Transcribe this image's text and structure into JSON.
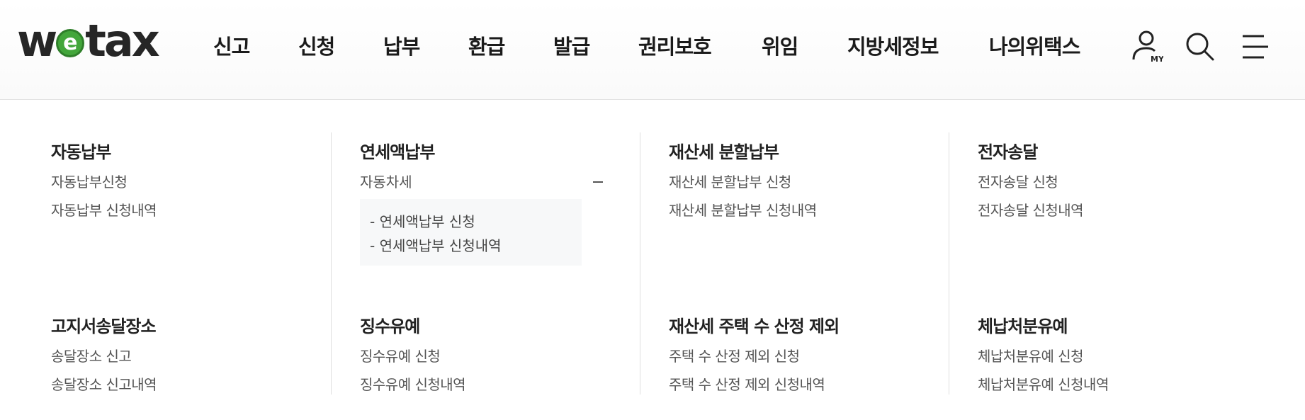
{
  "header": {
    "logo": {
      "w": "w",
      "e": "e",
      "tax": "tax"
    },
    "nav": [
      "신고",
      "신청",
      "납부",
      "환급",
      "발급",
      "권리보호",
      "위임",
      "지방세정보",
      "나의위택스"
    ],
    "icons": {
      "my": "user-my-icon",
      "my_label": "MY",
      "search": "search-icon",
      "menu": "hamburger-menu-icon"
    }
  },
  "menu": {
    "row1": [
      {
        "title": "자동납부",
        "links": [
          "자동납부신청",
          "자동납부 신청내역"
        ]
      },
      {
        "title": "연세액납부",
        "toggle_label": "자동차세",
        "toggle_icon": "minus-icon",
        "sub_links": [
          "- 연세액납부 신청",
          "- 연세액납부 신청내역"
        ]
      },
      {
        "title": "재산세 분할납부",
        "links": [
          "재산세 분할납부 신청",
          "재산세 분할납부 신청내역"
        ]
      },
      {
        "title": "전자송달",
        "links": [
          "전자송달 신청",
          "전자송달 신청내역"
        ]
      }
    ],
    "row2": [
      {
        "title": "고지서송달장소",
        "links": [
          "송달장소 신고",
          "송달장소 신고내역"
        ]
      },
      {
        "title": "징수유예",
        "links": [
          "징수유예 신청",
          "징수유예 신청내역"
        ]
      },
      {
        "title": "재산세 주택 수 산정 제외",
        "links": [
          "주택 수 산정 제외 신청",
          "주택 수 산정 제외 신청내역"
        ]
      },
      {
        "title": "체납처분유예",
        "links": [
          "체납처분유예 신청",
          "체납처분유예 신청내역"
        ]
      }
    ]
  },
  "colors": {
    "brand_green": "#43a63b",
    "text_dark": "#222222",
    "text_link": "#555555",
    "divider": "#dedede"
  }
}
